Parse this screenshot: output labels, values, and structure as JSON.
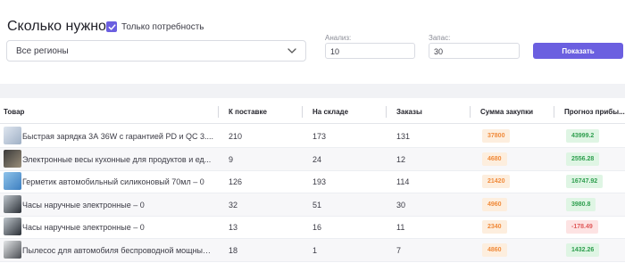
{
  "header": {
    "title": "Сколько нужно",
    "only_need_label": "Только потребность",
    "region_value": "Все регионы",
    "analysis_label": "Анализ:",
    "analysis_value": "10",
    "reserve_label": "Запас:",
    "reserve_value": "30",
    "show_button": "Показать"
  },
  "colors": {
    "accent": "#6b5fe0",
    "buy_badge_bg": "#fdeede",
    "buy_badge_text": "#f08a3a",
    "profit_pos_bg": "#dff5e4",
    "profit_pos_text": "#2e9e4e",
    "profit_neg_bg": "#fde3e3",
    "profit_neg_text": "#e05a5a"
  },
  "table": {
    "columns": [
      "Товар",
      "К поставке",
      "На складе",
      "Заказы",
      "Сумма закупки",
      "Прогноз прибы..."
    ],
    "rows": [
      {
        "name": "Быстрая зарядка 3А 36W с гарантией PD и QC 3....",
        "to_supply": "210",
        "in_stock": "173",
        "orders": "131",
        "purchase_sum": "37800",
        "profit": "43999.2",
        "profit_sign": "pos",
        "thumb": "charger-thumbnail"
      },
      {
        "name": "Электронные весы кухонные для продуктов и ед...",
        "to_supply": "9",
        "in_stock": "24",
        "orders": "12",
        "purchase_sum": "4680",
        "profit": "2556.28",
        "profit_sign": "pos",
        "thumb": "scale-thumbnail"
      },
      {
        "name": "Герметик автомобильный силиконовый 70мл – 0",
        "to_supply": "126",
        "in_stock": "193",
        "orders": "114",
        "purchase_sum": "21420",
        "profit": "16747.92",
        "profit_sign": "pos",
        "thumb": "sealant-thumbnail"
      },
      {
        "name": "Часы наручные электронные – 0",
        "to_supply": "32",
        "in_stock": "51",
        "orders": "30",
        "purchase_sum": "4960",
        "profit": "3980.8",
        "profit_sign": "pos",
        "thumb": "watch-thumbnail"
      },
      {
        "name": "Часы наручные электронные – 0",
        "to_supply": "13",
        "in_stock": "16",
        "orders": "11",
        "purchase_sum": "2340",
        "profit": "-178.49",
        "profit_sign": "neg",
        "thumb": "watch-thumbnail"
      },
      {
        "name": "Пылесос для автомобиля беспроводной мощный...",
        "to_supply": "18",
        "in_stock": "1",
        "orders": "7",
        "purchase_sum": "4860",
        "profit": "1432.26",
        "profit_sign": "pos",
        "thumb": "vacuum-thumbnail"
      }
    ]
  }
}
